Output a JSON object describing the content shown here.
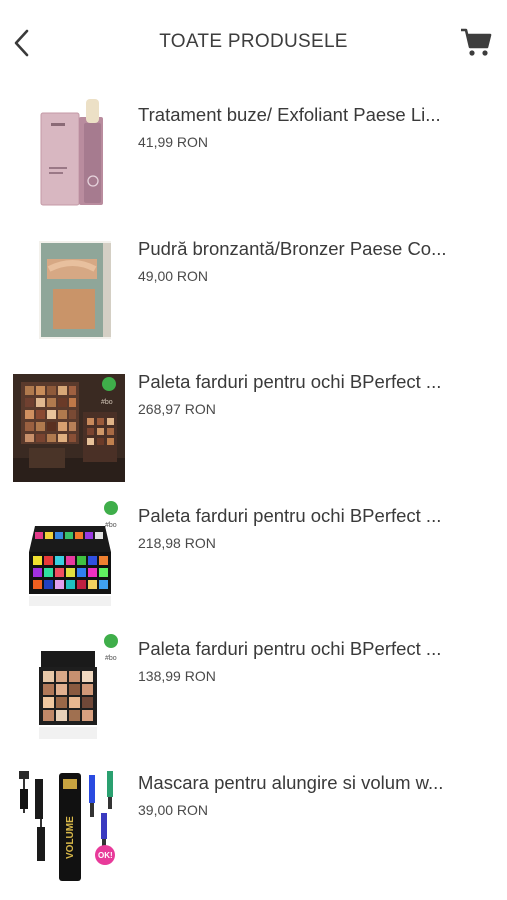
{
  "header": {
    "title": "TOATE PRODUSELE",
    "back_icon": "chevron-left-icon",
    "cart_icon": "shopping-cart-icon"
  },
  "products": [
    {
      "name": "Tratament buze/ Exfoliant Paese Li...",
      "price": "41,99 RON",
      "image": "lip-treatment-stick"
    },
    {
      "name": "Pudră bronzantă/Bronzer Paese Co...",
      "price": "49,00 RON",
      "image": "bronzer-compact"
    },
    {
      "name": "Paleta farduri pentru ochi BPerfect ...",
      "price": "268,97 RON",
      "image": "eyeshadow-palette-set"
    },
    {
      "name": "Paleta farduri pentru ochi BPerfect ...",
      "price": "218,98 RON",
      "image": "eyeshadow-palette-colorful"
    },
    {
      "name": "Paleta farduri pentru ochi BPerfect ...",
      "price": "138,99 RON",
      "image": "eyeshadow-palette-nude"
    },
    {
      "name": "Mascara pentru alungire si volum w...",
      "price": "39,00 RON",
      "image": "mascara-set"
    }
  ],
  "colors": {
    "badge": "#3fae4a",
    "text": "#3a3a3a"
  }
}
